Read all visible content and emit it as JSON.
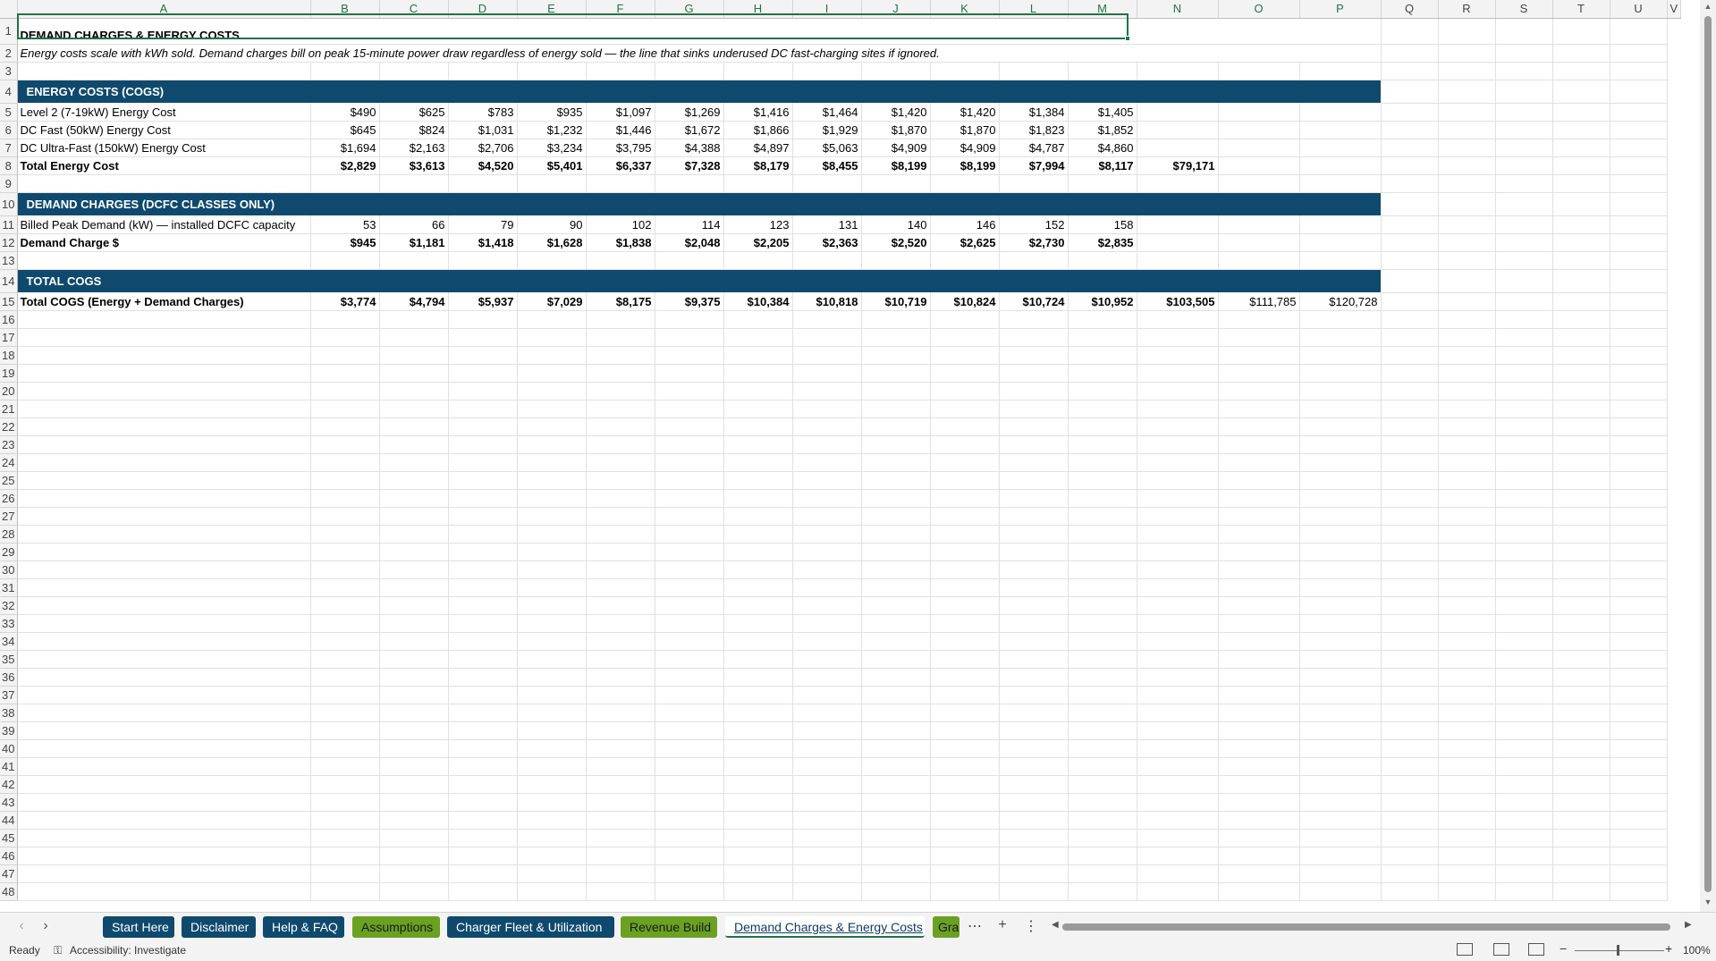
{
  "columns": [
    "A",
    "B",
    "C",
    "D",
    "E",
    "F",
    "G",
    "H",
    "I",
    "J",
    "K",
    "L",
    "M",
    "N",
    "O",
    "P",
    "Q",
    "R",
    "S",
    "T",
    "U",
    "V"
  ],
  "title": "DEMAND CHARGES & ENERGY COSTS",
  "subtitle": "Energy costs scale with kWh sold. Demand charges bill on peak 15-minute power draw regardless of energy sold — the line that sinks underused DC fast-charging sites if ignored.",
  "section_energy": "ENERGY COSTS (COGS)",
  "section_demand": "DEMAND CHARGES (DCFC CLASSES ONLY)",
  "section_total": "TOTAL COGS",
  "rows": {
    "l2": {
      "label": "Level 2 (7-19kW) Energy Cost",
      "values": [
        "$490",
        "$625",
        "$783",
        "$935",
        "$1,097",
        "$1,269",
        "$1,416",
        "$1,464",
        "$1,420",
        "$1,420",
        "$1,384",
        "$1,405"
      ]
    },
    "dcfast": {
      "label": "DC Fast (50kW) Energy Cost",
      "values": [
        "$645",
        "$824",
        "$1,031",
        "$1,232",
        "$1,446",
        "$1,672",
        "$1,866",
        "$1,929",
        "$1,870",
        "$1,870",
        "$1,823",
        "$1,852"
      ]
    },
    "ultra": {
      "label": "DC Ultra-Fast (150kW) Energy Cost",
      "values": [
        "$1,694",
        "$2,163",
        "$2,706",
        "$3,234",
        "$3,795",
        "$4,388",
        "$4,897",
        "$5,063",
        "$4,909",
        "$4,909",
        "$4,787",
        "$4,860"
      ]
    },
    "total_energy": {
      "label": "Total Energy Cost",
      "values": [
        "$2,829",
        "$3,613",
        "$4,520",
        "$5,401",
        "$6,337",
        "$7,328",
        "$8,179",
        "$8,455",
        "$8,199",
        "$8,199",
        "$7,994",
        "$8,117"
      ],
      "annual": "$79,171"
    },
    "peak": {
      "label": "Billed Peak Demand (kW) — installed DCFC capacity",
      "values": [
        "53",
        "66",
        "79",
        "90",
        "102",
        "114",
        "123",
        "131",
        "140",
        "146",
        "152",
        "158"
      ]
    },
    "demand_charge": {
      "label": "Demand Charge $",
      "values": [
        "$945",
        "$1,181",
        "$1,418",
        "$1,628",
        "$1,838",
        "$2,048",
        "$2,205",
        "$2,363",
        "$2,520",
        "$2,625",
        "$2,730",
        "$2,835"
      ]
    },
    "total_cogs": {
      "label": "Total COGS (Energy + Demand Charges)",
      "values": [
        "$3,774",
        "$4,794",
        "$5,937",
        "$7,029",
        "$8,175",
        "$9,375",
        "$10,384",
        "$10,818",
        "$10,719",
        "$10,824",
        "$10,724",
        "$10,952"
      ],
      "n": "$103,505",
      "o": "$111,785",
      "p": "$120,728"
    }
  },
  "tabs": [
    {
      "label": "Start Here",
      "bg": "#0f4a6e",
      "fg": "#ffffff"
    },
    {
      "label": "Disclaimer",
      "bg": "#0f4a6e",
      "fg": "#ffffff"
    },
    {
      "label": "Help & FAQ",
      "bg": "#0f4a6e",
      "fg": "#ffffff"
    },
    {
      "label": "Assumptions",
      "bg": "#6aa121",
      "fg": "#1a1a1a"
    },
    {
      "label": "Charger Fleet & Utilization",
      "bg": "#0f4a6e",
      "fg": "#ffffff"
    },
    {
      "label": "Revenue Build",
      "bg": "#6aa121",
      "fg": "#1a1a1a"
    },
    {
      "label": "Demand Charges & Energy Costs",
      "bg": "#ffffff",
      "fg": "#0f3c64",
      "active": true
    },
    {
      "label": "Gra",
      "bg": "#6aa121",
      "fg": "#1a1a1a"
    }
  ],
  "status": {
    "ready": "Ready",
    "accessibility": "Accessibility: Investigate",
    "zoom": "100%"
  },
  "colors": {
    "band": "#0f4a6e",
    "accent_green": "#217346"
  }
}
